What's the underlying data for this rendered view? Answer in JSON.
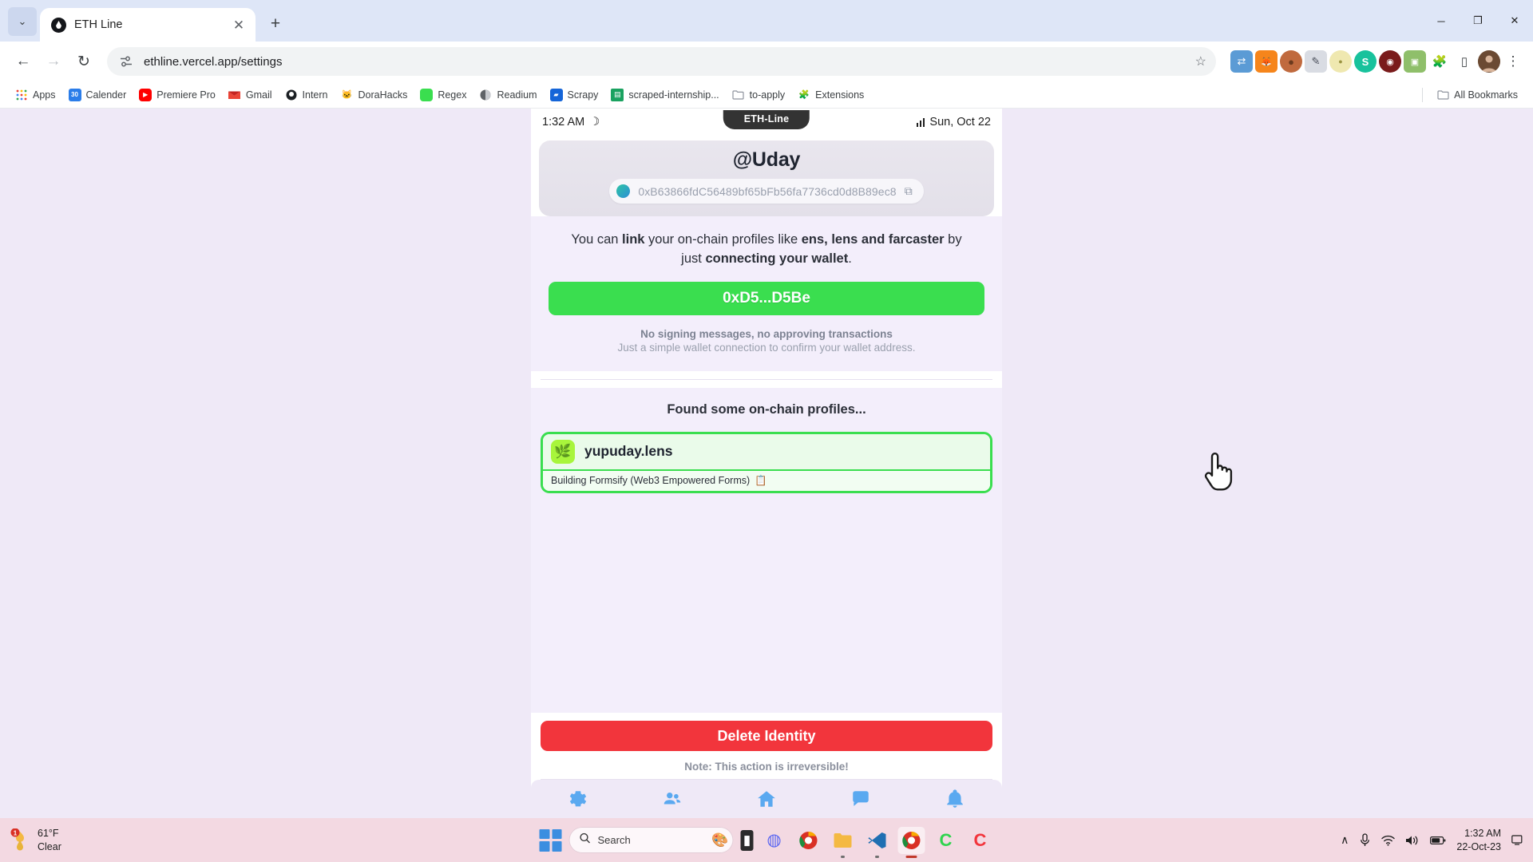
{
  "browser": {
    "tab": {
      "title": "ETH Line",
      "favicon": "eth-droplet-icon",
      "close_label": "✕"
    },
    "new_tab_label": "+",
    "tab_search_label": "⌄",
    "window_controls": {
      "minimize": "─",
      "maximize": "❐",
      "close": "✕"
    },
    "nav": {
      "back": "←",
      "forward": "→",
      "reload": "↻"
    },
    "omnibox": {
      "url": "ethline.vercel.app/settings",
      "site_icon": "tune-settings-icon",
      "bookmark_star": "☆"
    },
    "extensions": [
      {
        "name": "sync-extension-icon",
        "glyph": "⇄",
        "bg": "#5b9bd5",
        "fg": "#ffffff"
      },
      {
        "name": "metamask-extension-icon",
        "glyph": "ᾘa",
        "bg": "#f6851b",
        "fg": "#ffffff"
      },
      {
        "name": "cookie-extension-icon",
        "glyph": "●",
        "bg": "#c06a3e",
        "fg": "#ffffff"
      },
      {
        "name": "notes-extension-icon",
        "glyph": "✎",
        "bg": "#d9dce3",
        "fg": "#4a4f5a"
      },
      {
        "name": "dot-extension-icon",
        "glyph": "●",
        "bg": "#e8e2a8",
        "fg": "#8a8535"
      },
      {
        "name": "s-extension-icon",
        "glyph": "S",
        "bg": "#18c29c",
        "fg": "#ffffff"
      },
      {
        "name": "ublock-extension-icon",
        "glyph": "◉",
        "bg": "#7a1b1b",
        "fg": "#ffffff"
      },
      {
        "name": "screenshot-extension-icon",
        "glyph": "▣",
        "bg": "#8fbf6a",
        "fg": "#ffffff"
      },
      {
        "name": "puzzle-extensions-icon",
        "glyph": "✦",
        "bg": "#ffffff",
        "fg": "#5f6368"
      },
      {
        "name": "side-panel-icon",
        "glyph": "◫",
        "bg": "#ffffff",
        "fg": "#3c4043"
      }
    ],
    "menu_label": "⋮",
    "bookmarks": [
      {
        "label": "Apps",
        "icon": "apps-grid-icon",
        "glyph": "∷",
        "bg": "#ffffff",
        "fg": "#e05c4a"
      },
      {
        "label": "Calender",
        "icon": "google-calendar-icon",
        "glyph": "30",
        "bg": "#2b7de9",
        "fg": "#ffffff"
      },
      {
        "label": "Premiere Pro",
        "icon": "youtube-icon",
        "glyph": "▶",
        "bg": "#ff0000",
        "fg": "#ffffff"
      },
      {
        "label": "Gmail",
        "icon": "gmail-icon",
        "glyph": "M",
        "bg": "#ffffff",
        "fg": "#ea4335"
      },
      {
        "label": "Intern",
        "icon": "github-icon",
        "glyph": "●",
        "bg": "#ffffff",
        "fg": "#1b1f23"
      },
      {
        "label": "DoraHacks",
        "icon": "dorahacks-icon",
        "glyph": "♟",
        "bg": "#ffffff",
        "fg": "#1b1f23"
      },
      {
        "label": "Regex",
        "icon": "regex-green-icon",
        "glyph": "⌇",
        "bg": "#3ade4f",
        "fg": "#ffffff"
      },
      {
        "label": "Readium",
        "icon": "readium-icon",
        "glyph": "◑",
        "bg": "#ffffff",
        "fg": "#4a4f5a"
      },
      {
        "label": "Scrapy",
        "icon": "scrapy-icon",
        "glyph": "▰",
        "bg": "#1565d8",
        "fg": "#ffffff"
      },
      {
        "label": "scraped-internship...",
        "icon": "sheets-icon",
        "glyph": "⌸",
        "bg": "#1aa260",
        "fg": "#ffffff"
      },
      {
        "label": "to-apply",
        "icon": "folder-icon",
        "glyph": "▬",
        "bg": "#ffffff",
        "fg": "#8f949e"
      },
      {
        "label": "Extensions",
        "icon": "extensions-puzzle-icon",
        "glyph": "✦",
        "bg": "#ffffff",
        "fg": "#3c4043"
      }
    ],
    "all_bookmarks": {
      "label": "All Bookmarks",
      "icon": "folder-icon",
      "glyph": "▬"
    }
  },
  "app": {
    "status_bar": {
      "time": "1:32 AM",
      "moon_icon": "☽",
      "notch_title": "ETH-Line",
      "signal_icon": "signal-bars-icon",
      "date": "Sun, Oct 22"
    },
    "profile": {
      "handle": "@Uday",
      "address": "0xB63866fdC56489bf65bFb56fa7736cd0d8B89ec8",
      "address_dot": "chain-dot-icon",
      "copy_icon": "⧉"
    },
    "link_section": {
      "line1_a": "You can ",
      "line1_b": "link",
      "line1_c": " your on-chain profiles like ",
      "line1_d": "ens, lens and farcaster",
      "line1_e": " by",
      "line2_a": "just ",
      "line2_b": "connecting your wallet",
      "line2_c": ".",
      "connect_button": "0xD5...D5Be",
      "note_strong": "No signing messages, no approving transactions",
      "note_sub": "Just a simple wallet connection to confirm your wallet address."
    },
    "profiles_section": {
      "title": "Found some on-chain profiles...",
      "items": [
        {
          "name": "yupuday.lens",
          "icon": "lens-profile-icon",
          "icon_glyph": "⚘",
          "bio": "Building Formsify (Web3 Empowered Forms)",
          "bio_icon": "Ὄb"
        }
      ]
    },
    "danger": {
      "delete_button": "Delete Identity",
      "note": "Note: This action is irreversible!"
    },
    "tabbar": [
      {
        "name": "settings",
        "icon": "gear-icon",
        "glyph": "⚙"
      },
      {
        "name": "people",
        "icon": "people-icon",
        "glyph": "὆5"
      },
      {
        "name": "home",
        "icon": "home-icon",
        "glyph": "⌂"
      },
      {
        "name": "chat",
        "icon": "chat-icon",
        "glyph": "Ὂc"
      },
      {
        "name": "notifications",
        "icon": "bell-icon",
        "glyph": "ὑ4"
      }
    ]
  },
  "taskbar": {
    "weather": {
      "temp": "61°F",
      "condition": "Clear",
      "badge": "1",
      "icon": "weather-clear-icon"
    },
    "start_label": "start-icon",
    "search_placeholder": "Search",
    "apps": [
      {
        "name": "paint-app-icon",
        "glyph": "Ἲ8",
        "bg": "transparent",
        "fg": "#3aa0d8",
        "running": false
      },
      {
        "name": "file-explorer-dark-icon",
        "glyph": "▮",
        "bg": "#2b2b2b",
        "fg": "#ffffff",
        "running": false
      },
      {
        "name": "discord-icon",
        "glyph": "●",
        "bg": "#5865f2",
        "fg": "#ffffff",
        "running": false
      },
      {
        "name": "chrome-secondary-icon",
        "glyph": "◎",
        "bg": "#e8453c",
        "fg": "#ffffff",
        "running": true
      },
      {
        "name": "folder-icon",
        "glyph": "▰",
        "bg": "#f4b942",
        "fg": "#ffffff",
        "running": false
      },
      {
        "name": "vscode-icon",
        "glyph": "✖",
        "bg": "transparent",
        "fg": "#1f6fb2",
        "running": false
      },
      {
        "name": "chrome-active-icon",
        "glyph": "◎",
        "bg": "transparent",
        "fg": "#e8453c",
        "running": true
      },
      {
        "name": "terminal-green-icon",
        "glyph": "C",
        "bg": "#2fd44e",
        "fg": "#ffffff",
        "running": false
      },
      {
        "name": "canva-red-icon",
        "glyph": "C",
        "bg": "#f2353c",
        "fg": "#ffffff",
        "running": false
      }
    ],
    "tray": {
      "chevron": "∧",
      "mic_icon": "Ἲ4",
      "wifi_icon": "◠",
      "volume_icon": "ὐa",
      "battery_icon": "▭",
      "time": "1:32 AM",
      "date": "22-Oct-23",
      "notifications_icon": "὚5"
    }
  }
}
